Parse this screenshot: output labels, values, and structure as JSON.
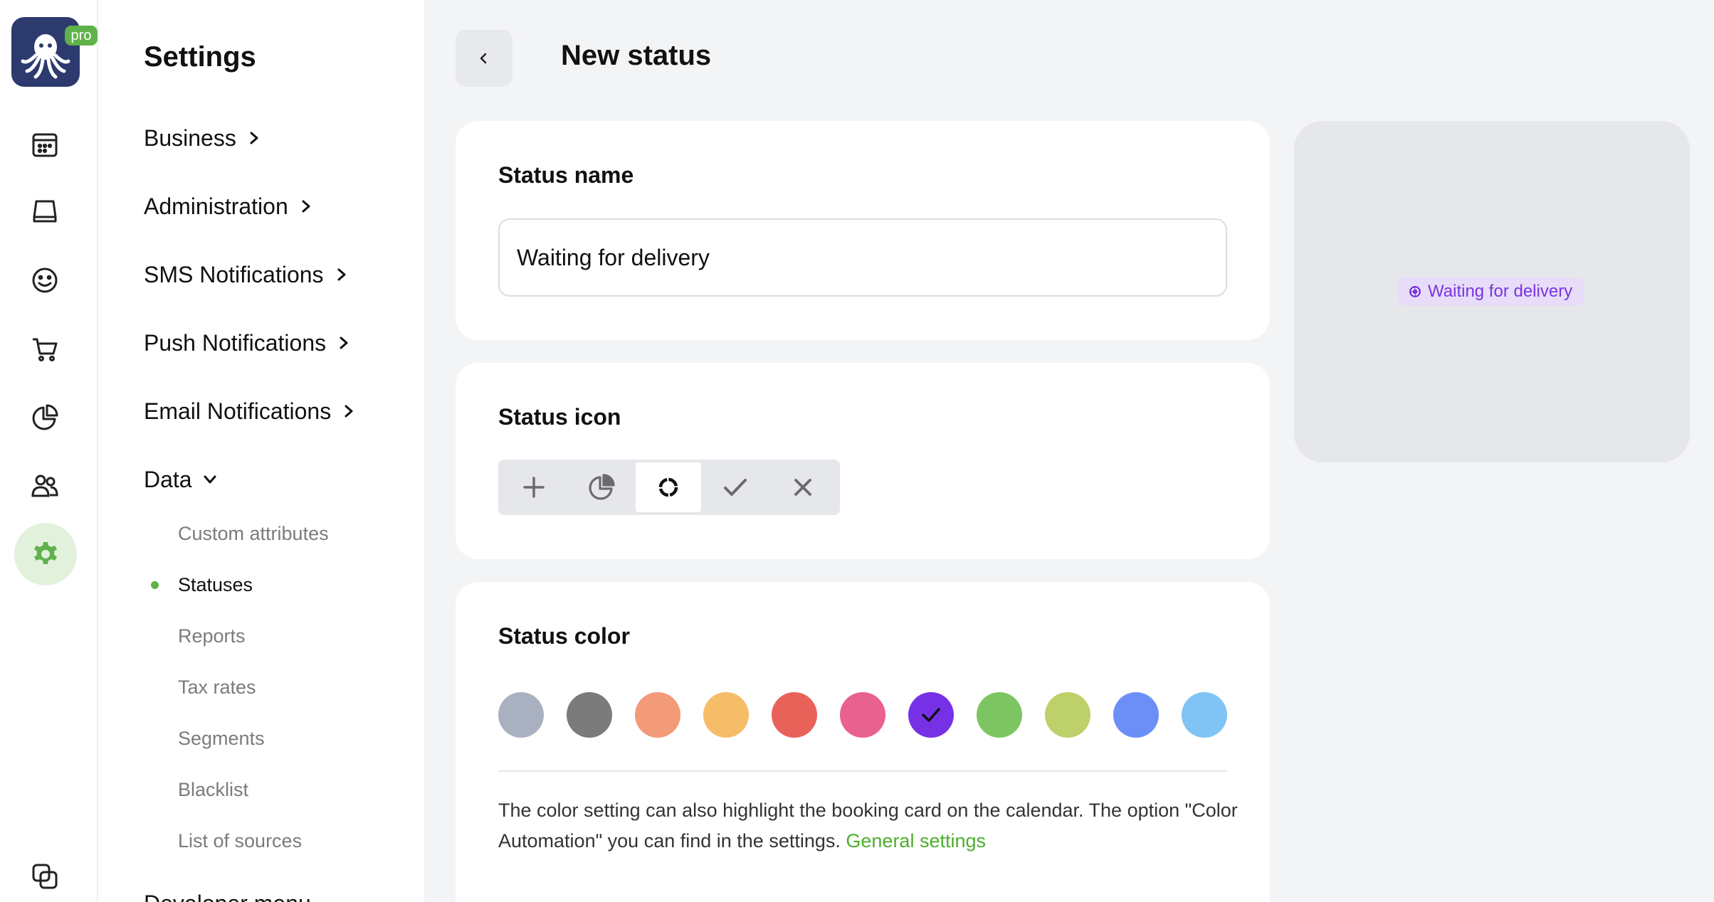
{
  "app": {
    "badge": "pro"
  },
  "rail": {
    "icons": [
      "calendar-icon",
      "inbox-icon",
      "smiley-icon",
      "cart-icon",
      "pie-chart-icon",
      "users-icon",
      "gear-icon",
      "copy-icon"
    ],
    "active": "gear-icon"
  },
  "menu": {
    "title": "Settings",
    "items": [
      {
        "label": "Business",
        "expanded": false
      },
      {
        "label": "Administration",
        "expanded": false
      },
      {
        "label": "SMS Notifications",
        "expanded": false
      },
      {
        "label": "Push Notifications",
        "expanded": false
      },
      {
        "label": "Email Notifications",
        "expanded": false
      },
      {
        "label": "Data",
        "expanded": true
      }
    ],
    "data_subitems": [
      "Custom attributes",
      "Statuses",
      "Reports",
      "Tax rates",
      "Segments",
      "Blacklist",
      "List of sources"
    ],
    "active_subitem": "Statuses",
    "cut_item": "Developer menu"
  },
  "page": {
    "title": "New status",
    "back_icon": "chevron-left-icon"
  },
  "status_name": {
    "title": "Status name",
    "value": "Waiting for delivery"
  },
  "status_icon": {
    "title": "Status icon",
    "options": [
      "plus-icon",
      "pie-chart-icon",
      "progress-ring-icon",
      "check-icon",
      "close-icon"
    ],
    "selected": "progress-ring-icon"
  },
  "status_color": {
    "title": "Status color",
    "swatches": [
      "#a9b1c1",
      "#7b7b7b",
      "#f39a78",
      "#f6bd68",
      "#e8625a",
      "#e8618f",
      "#7631e6",
      "#7dc562",
      "#bdd06a",
      "#6c8ff7",
      "#80c4f5"
    ],
    "selected": "#7631e6",
    "note": "The color setting can also highlight the booking card on the calendar. The option \"Color Automation\" you can find in the settings.",
    "link": "General settings"
  },
  "preview": {
    "badge_text": "Waiting for delivery",
    "badge_color": "#7a35e0",
    "badge_bg": "#e7ddf8"
  }
}
